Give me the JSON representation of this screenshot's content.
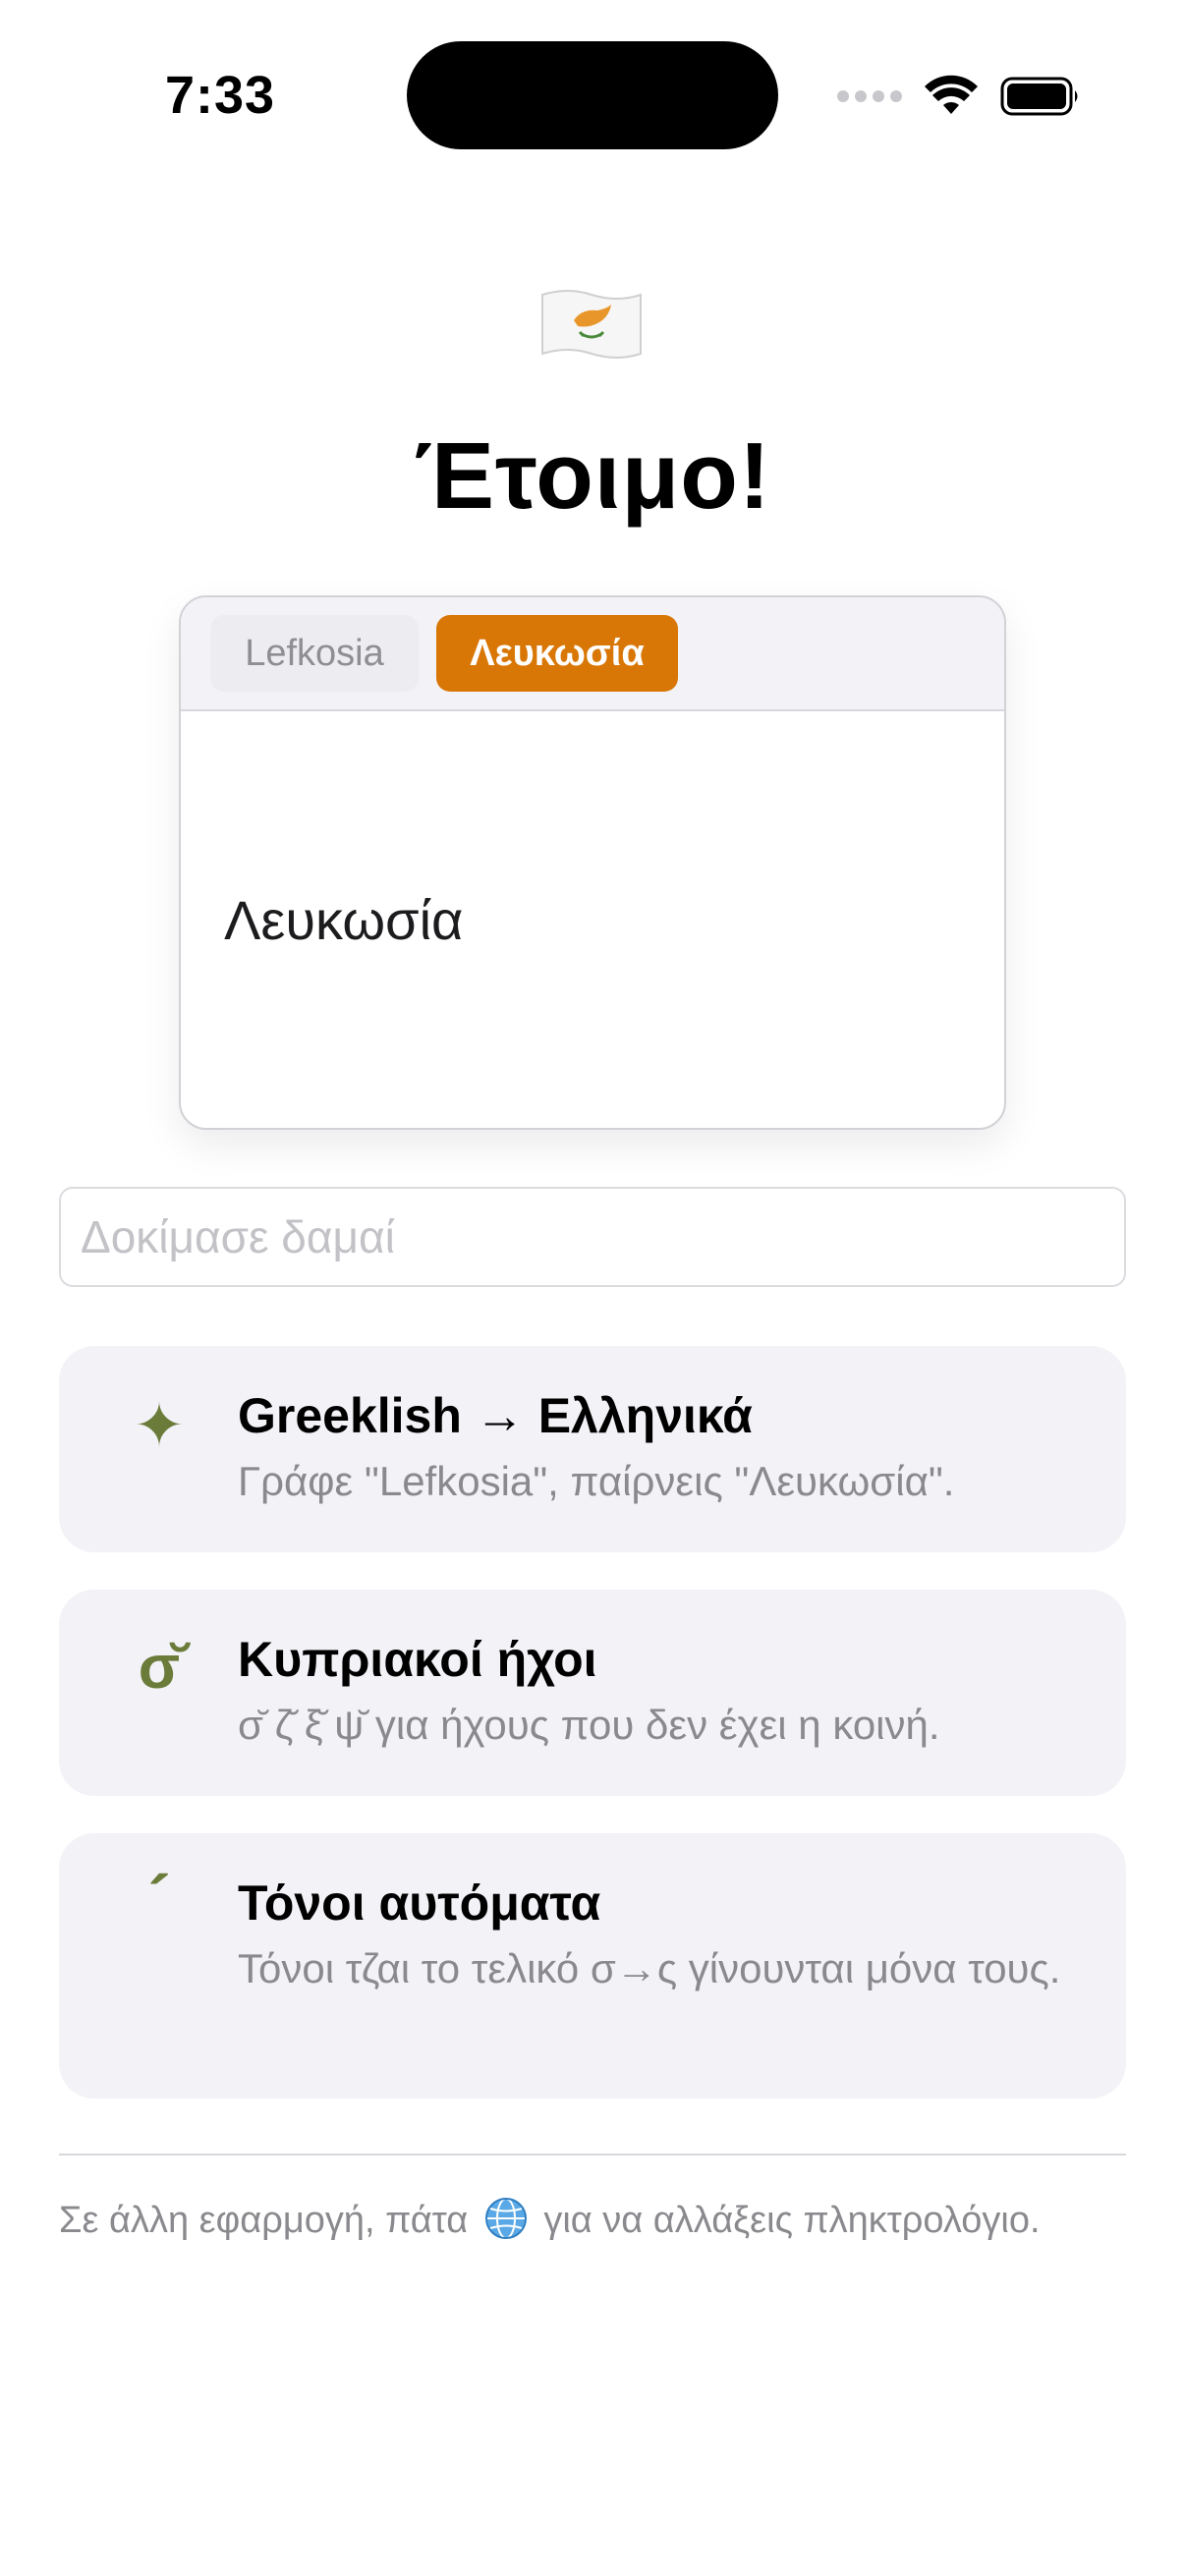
{
  "status_bar": {
    "time": "7:33"
  },
  "header": {
    "flag": "cyprus-flag-icon",
    "title": "Έτοιμο!"
  },
  "preview": {
    "tabs": [
      {
        "label": "Lefkosia",
        "selected": false
      },
      {
        "label": "Λευκωσία",
        "selected": true
      }
    ],
    "output": "Λευκωσία"
  },
  "input": {
    "placeholder": "Δοκίμασε δαμαί",
    "value": ""
  },
  "features": [
    {
      "icon": "✦",
      "icon_name": "sparkle-icon",
      "title": "Greeklish → Ελληνικά",
      "desc": "Γράφε \"Lefkosia\", παίρνεις \"Λευκωσία\"."
    },
    {
      "icon": "σ̆",
      "icon_name": "breve-sigma-icon",
      "title": "Κυπριακοί ήχοι",
      "desc": "σ̆ ζ̆ ξ̆ ψ̆ για ήχους που δεν έχει η κοινή."
    },
    {
      "icon": "´",
      "icon_name": "accent-icon",
      "title": "Τόνοι αυτόματα",
      "desc": "Τόνοι τζαι το τελικό σ→ς γίνουνται μόνα τους."
    }
  ],
  "footer": {
    "before": "Σε άλλη εφαρμογή, πάτα",
    "after": "για να αλλάξεις πληκτρολόγιο."
  },
  "colors": {
    "accent": "#d97706",
    "icon_green": "#6b7c3a",
    "card_bg": "#f2f2f7"
  }
}
